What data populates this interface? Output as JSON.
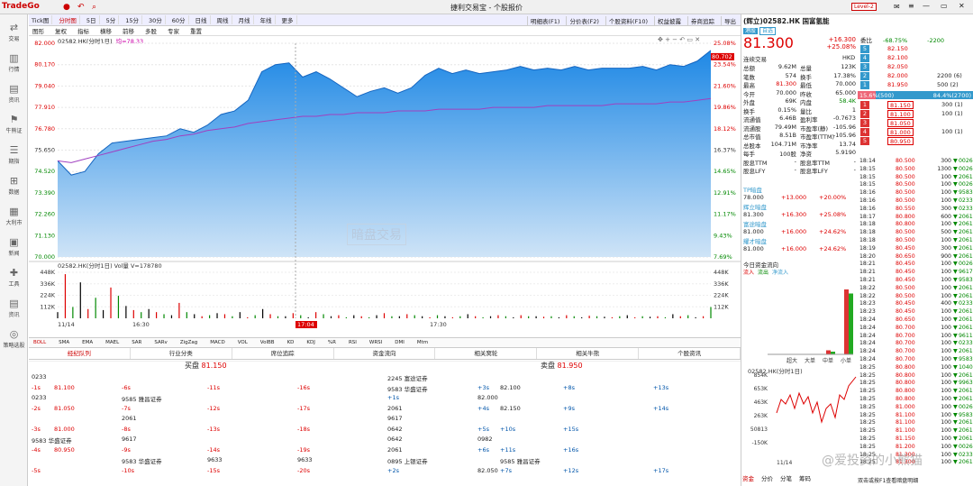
{
  "app": {
    "logo": "TradeGo",
    "title": "捷利交易宝 - 个股报价",
    "level": "Level-2"
  },
  "nav": [
    "交易",
    "行情",
    "资讯",
    "牛熊证",
    "期指",
    "数据",
    "大利市",
    "新闻",
    "工具",
    "资讯",
    "策略选股"
  ],
  "tabs1": [
    "Tick图",
    "分时图",
    "5日",
    "5分",
    "15分",
    "30分",
    "60分",
    "日线",
    "周线",
    "月线",
    "年线",
    "更多"
  ],
  "tabs1_active": 1,
  "tabs2": [
    "图形",
    "复权",
    "指标",
    "横移",
    "前移",
    "多股",
    "专家",
    "重置"
  ],
  "rtabs": [
    "明细表(F1)",
    "分价表(F2)",
    "个股资料(F10)",
    "权益披露",
    "券商追踪",
    "导出"
  ],
  "chart_info": {
    "label": "02582.HK(分时1日)",
    "avg": "均=78.33"
  },
  "chart_data": {
    "type": "line",
    "title": "02582.HK(分时1日)",
    "yleft": [
      "82.000",
      "80.170",
      "79.040",
      "77.910",
      "76.780",
      "75.650",
      "74.520",
      "73.390",
      "72.260",
      "71.130",
      "70.000"
    ],
    "yright": [
      "25.08%",
      "23.54%",
      "21.60%",
      "19.86%",
      "18.12%",
      "16.37%",
      "14.65%",
      "12.91%",
      "11.17%",
      "9.43%",
      "7.69%"
    ],
    "price_label": "80.702",
    "price": [
      75.4,
      74.6,
      74.8,
      75.8,
      76.4,
      76.5,
      76.6,
      76.7,
      76.8,
      77.2,
      77.0,
      77.4,
      78.0,
      78.2,
      78.8,
      80.4,
      80.8,
      80.9,
      80.1,
      80.4,
      80.0,
      79.5,
      79.0,
      79.3,
      79.5,
      79.2,
      79.5,
      80.2,
      80.6,
      80.3,
      80.5,
      80.3,
      80.4,
      80.5,
      80.7,
      80.5,
      80.6,
      80.5,
      80.7,
      80.5,
      80.6,
      80.6,
      80.6,
      80.7,
      80.5,
      80.8,
      80.7,
      81.0,
      81.6
    ],
    "avg": [
      75.4,
      75.3,
      75.5,
      75.7,
      75.9,
      76.1,
      76.3,
      76.5,
      76.6,
      76.8,
      76.9,
      77.1,
      77.2,
      77.3,
      77.5,
      77.6,
      77.7,
      77.8,
      77.9,
      77.9,
      78.0,
      78.0,
      78.1,
      78.1,
      78.1,
      78.2,
      78.2,
      78.2,
      78.3,
      78.3,
      78.3,
      78.3,
      78.4,
      78.4,
      78.4,
      78.4,
      78.5,
      78.5,
      78.5,
      78.5,
      78.5,
      78.6,
      78.6,
      78.6,
      78.6,
      78.7,
      78.7,
      78.8,
      78.9
    ],
    "ymin": 70.0,
    "ymax": 82.0,
    "vol_label": "02582.HK(分时1日) Vol量 V=178780",
    "vol_yticks": [
      "448K",
      "336K",
      "224K",
      "112K"
    ],
    "vol_ymax": 448,
    "volumes": [
      60,
      430,
      110,
      350,
      90,
      200,
      80,
      300,
      220,
      120,
      80,
      60,
      90,
      60,
      40,
      30,
      150,
      60,
      40,
      20,
      30,
      50,
      40,
      20,
      60,
      10,
      30,
      90,
      40,
      20,
      20,
      50,
      30,
      10,
      60,
      40,
      20,
      30,
      10,
      30,
      20,
      10,
      30,
      50,
      20,
      20,
      40,
      30,
      20,
      10,
      30,
      20,
      10,
      20,
      40,
      20,
      10,
      20,
      30,
      20,
      10,
      30,
      20,
      20,
      15,
      20,
      10,
      30,
      20,
      10,
      25,
      20,
      15,
      10,
      20,
      30,
      10,
      20,
      15,
      20,
      10,
      40,
      20,
      30,
      10,
      20,
      110
    ],
    "xlabels": [
      "11/14",
      "16:30",
      "17:04",
      "17:30"
    ]
  },
  "wm": "暗盘交易",
  "indicators": [
    "BOLL",
    "SMA",
    "EMA",
    "MAEL",
    "SAR",
    "SARv",
    "ZigZag",
    "MACD",
    "VOL",
    "VolBB",
    "KD",
    "KDJ",
    "%R",
    "RSI",
    "WRSI",
    "DMI",
    "Mtm"
  ],
  "ordtabs": [
    "经纪队列",
    "行业分类",
    "席位追踪",
    "资金流向",
    "相关窝轮",
    "相关牛熊",
    "个股资讯"
  ],
  "orderbook": {
    "bid_label": "买盘",
    "bid_price": "81.150",
    "ask_label": "卖盘",
    "ask_price": "81.950",
    "bid_rows": [
      [
        "0233",
        "",
        "",
        ""
      ],
      [
        "-1s",
        "81.100",
        "-6s",
        "-11s",
        "-16s"
      ],
      [
        "0233",
        "",
        "9585 雅昌证券",
        ""
      ],
      [
        "-2s",
        "81.050",
        "-7s",
        "-12s",
        "-17s"
      ],
      [
        "",
        "",
        "2061",
        ""
      ],
      [
        "-3s",
        "81.000",
        "-8s",
        "-13s",
        "-18s"
      ],
      [
        "9583 华盛证券",
        "",
        "9617",
        ""
      ],
      [
        "-4s",
        "80.950",
        "-9s",
        "-14s",
        "-19s"
      ],
      [
        "",
        "",
        "9583 华盛证券",
        "9633",
        "9633"
      ],
      [
        "-5s",
        "",
        "-10s",
        "-15s",
        "-20s"
      ]
    ],
    "ask_rows": [
      [
        "2245 富途证券",
        "",
        ""
      ],
      [
        "9583 华盛证券",
        "+3s",
        "82.100",
        "+8s",
        "+13s"
      ],
      [
        "+1s",
        "82.000",
        "",
        ""
      ],
      [
        "2061",
        "+4s",
        "82.150",
        "+9s",
        "+14s"
      ],
      [
        "9617",
        "",
        ""
      ],
      [
        "0642",
        "+5s",
        "+10s",
        "+15s"
      ],
      [
        "0642",
        "0982",
        ""
      ],
      [
        "2061",
        "+6s",
        "+11s",
        "+16s"
      ],
      [
        "0895 上银证券",
        "",
        "9585 雅昌证券"
      ],
      [
        "+2s",
        "82.050",
        "+7s",
        "+12s",
        "+17s"
      ]
    ]
  },
  "quote": {
    "title": "(辉立)02582.HK 国富氢能",
    "price": "81.300",
    "chg": "+16.300",
    "pct": "+25.08%",
    "tag1": "港股",
    "tag2": "自选",
    "board": "连续交易",
    "cur": "HKD",
    "fields": [
      [
        "总额",
        "9.62M",
        "总量",
        "123K"
      ],
      [
        "笔数",
        "574",
        "换手",
        "17.38%"
      ],
      [
        "最高",
        "81.300",
        "最低",
        "70.000"
      ],
      [
        "今开",
        "70.000",
        "昨收",
        "65.000"
      ],
      [
        "外盘",
        "69K",
        "内盘",
        "58.4K"
      ],
      [
        "换手",
        "0.15%",
        "量比",
        "1"
      ],
      [
        "流通值",
        "6.46B",
        "盈利率",
        "-0.7673"
      ],
      [
        "流通股",
        "79.49M",
        "市盈率(静)",
        "-105.96"
      ],
      [
        "总市值",
        "8.51B",
        "市盈率(TTM)",
        "-105.96"
      ],
      [
        "总股本",
        "104.71M",
        "市净率",
        "13.74"
      ],
      [
        "每手",
        "100股",
        "净资",
        "5.9190"
      ],
      [
        "股息TTM",
        "-",
        "股息率TTM",
        "-"
      ],
      [
        "股息LFY",
        "-",
        "股息率LFY",
        "-"
      ]
    ],
    "dark": [
      [
        "TP暗盘",
        "",
        ""
      ],
      [
        "78.000",
        "+13.000",
        "+20.00%"
      ],
      [
        "辉立暗盘",
        "",
        ""
      ],
      [
        "81.300",
        "+16.300",
        "+25.08%"
      ],
      [
        "富途暗盘",
        "",
        ""
      ],
      [
        "81.000",
        "+16.000",
        "+24.62%"
      ],
      [
        "耀才暗盘",
        "",
        ""
      ],
      [
        "81.000",
        "+16.000",
        "+24.62%"
      ]
    ],
    "flow_title": "今日资金流向",
    "flow_legend": [
      "流入",
      "流出",
      "净流入"
    ],
    "flow_bars": [
      {
        "name": "超大",
        "in": 0,
        "out": 0
      },
      {
        "name": "大单",
        "in": 0,
        "out": 0
      },
      {
        "name": "中单",
        "in": 3,
        "out": 2
      },
      {
        "name": "小单",
        "in": 48,
        "out": 45
      }
    ],
    "mini_title": "02582.HK(分时1日)",
    "mini_y": [
      "854K",
      "653K",
      "463K",
      "263K",
      "50813",
      "-150K"
    ],
    "mini_x": "11/14",
    "btabs": [
      "资金",
      "分价",
      "分笔",
      "筹码"
    ]
  },
  "depth": {
    "entrust": "委比",
    "ratio": "-68.75%",
    "diff": "-2200",
    "asks": [
      [
        "5",
        "82.150",
        ""
      ],
      [
        "4",
        "82.100",
        ""
      ],
      [
        "3",
        "82.050",
        ""
      ],
      [
        "2",
        "82.000",
        "2200 (6)"
      ],
      [
        "1",
        "81.950",
        "500 (2)"
      ]
    ],
    "buypct": "15.6%(500)",
    "sellpct": "84.4%(2700)",
    "bids": [
      [
        "1",
        "81.150",
        "300 (1)"
      ],
      [
        "2",
        "81.100",
        "100 (1)"
      ],
      [
        "3",
        "81.050",
        ""
      ],
      [
        "4",
        "81.000",
        "100 (1)"
      ],
      [
        "5",
        "80.950",
        ""
      ]
    ],
    "ticks": [
      [
        "18:14",
        "80.500",
        "300",
        "0026"
      ],
      [
        "18:15",
        "80.500",
        "1300",
        "0026"
      ],
      [
        "18:15",
        "80.500",
        "100",
        "2061"
      ],
      [
        "18:15",
        "80.500",
        "100",
        "0026"
      ],
      [
        "18:16",
        "80.500",
        "100",
        "9583"
      ],
      [
        "18:16",
        "80.500",
        "100",
        "0233"
      ],
      [
        "18:16",
        "80.550",
        "300",
        "0233"
      ],
      [
        "18:17",
        "80.800",
        "600",
        "2061"
      ],
      [
        "18:18",
        "80.800",
        "100",
        "2061"
      ],
      [
        "18:18",
        "80.500",
        "500",
        "2061"
      ],
      [
        "18:18",
        "80.500",
        "100",
        "2061"
      ],
      [
        "18:19",
        "80.450",
        "300",
        "2061"
      ],
      [
        "18:20",
        "80.650",
        "900",
        "2061"
      ],
      [
        "18:21",
        "80.450",
        "100",
        "0026"
      ],
      [
        "18:21",
        "80.450",
        "100",
        "9617"
      ],
      [
        "18:21",
        "80.450",
        "100",
        "9583"
      ],
      [
        "18:22",
        "80.500",
        "100",
        "2061"
      ],
      [
        "18:22",
        "80.500",
        "100",
        "2061"
      ],
      [
        "18:23",
        "80.450",
        "400",
        "0233"
      ],
      [
        "18:23",
        "80.450",
        "100",
        "2061"
      ],
      [
        "18:24",
        "80.650",
        "100",
        "2061"
      ],
      [
        "18:24",
        "80.700",
        "100",
        "2061"
      ],
      [
        "18:24",
        "80.700",
        "100",
        "9611"
      ],
      [
        "18:24",
        "80.700",
        "100",
        "0233"
      ],
      [
        "18:24",
        "80.700",
        "100",
        "2061"
      ],
      [
        "18:24",
        "80.700",
        "100",
        "9583"
      ],
      [
        "18:25",
        "80.800",
        "100",
        "1040"
      ],
      [
        "18:25",
        "80.800",
        "100",
        "2061"
      ],
      [
        "18:25",
        "80.800",
        "100",
        "9963"
      ],
      [
        "18:25",
        "80.800",
        "100",
        "2061"
      ],
      [
        "18:25",
        "80.800",
        "100",
        "2061"
      ],
      [
        "18:25",
        "81.000",
        "100",
        "0026"
      ],
      [
        "18:25",
        "81.100",
        "100",
        "9583"
      ],
      [
        "18:25",
        "81.100",
        "100",
        "2061"
      ],
      [
        "18:25",
        "81.100",
        "100",
        "2061"
      ],
      [
        "18:25",
        "81.150",
        "100",
        "2061"
      ],
      [
        "18:25",
        "81.200",
        "100",
        "0026"
      ],
      [
        "18:25",
        "81.300",
        "100",
        "0233"
      ],
      [
        "18:25",
        "81.300",
        "100",
        "2061"
      ]
    ],
    "foot": "双击或按F1查看暗盘明细"
  },
  "wm2": "@爱投资的小熊猫"
}
